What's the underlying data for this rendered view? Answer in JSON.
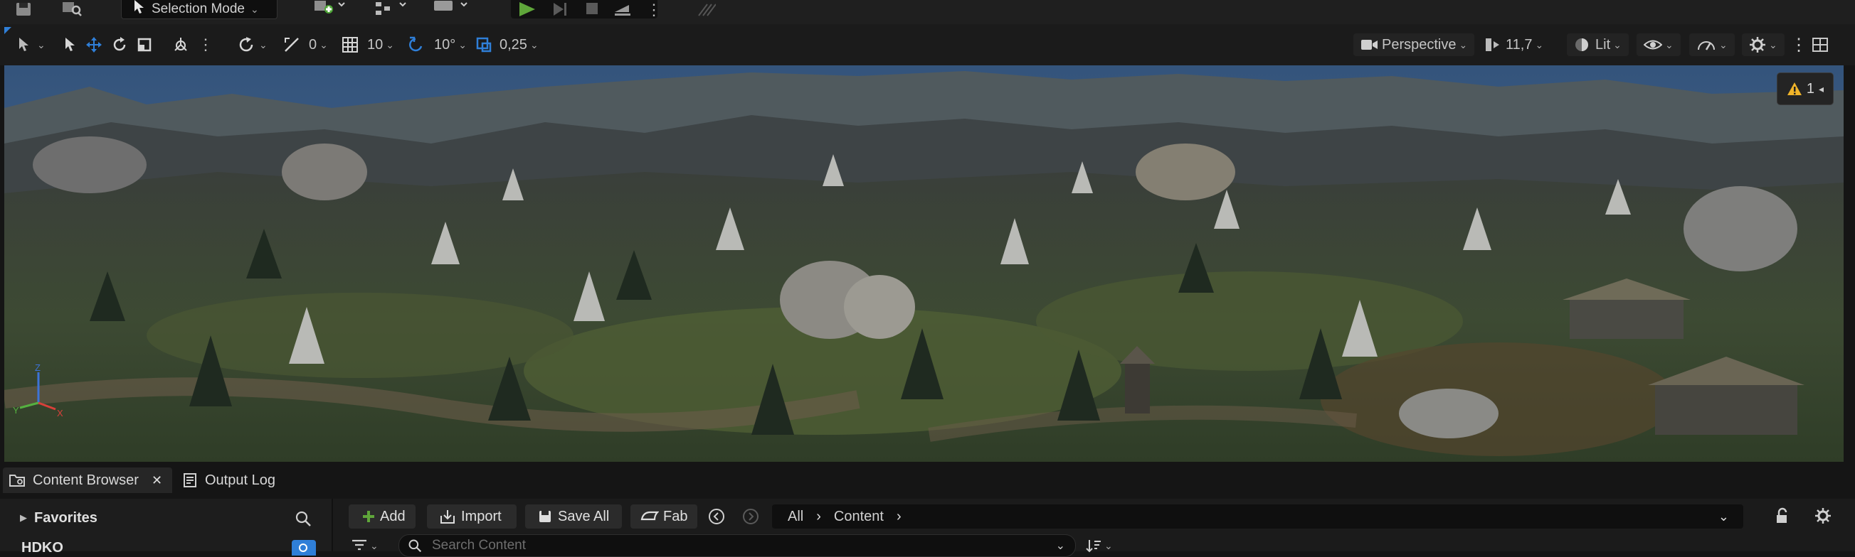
{
  "top_toolbar": {
    "selection_mode_label": "Selection Mode"
  },
  "viewport_toolbar": {
    "translate_snap": "0",
    "grid_snap": "10",
    "rotate_snap": "10°",
    "scale_snap": "0,25",
    "view_mode": "Perspective",
    "camera_speed": "11,7",
    "lighting_mode": "Lit"
  },
  "viewport": {
    "warning_count": "1",
    "axis_labels": {
      "z": "Z",
      "y": "Y",
      "x": "X"
    }
  },
  "tabs": {
    "content_browser": "Content Browser",
    "output_log": "Output Log"
  },
  "content_browser": {
    "favorites": "Favorites",
    "project_folder": "HDKO",
    "add_label": "Add",
    "import_label": "Import",
    "save_all_label": "Save All",
    "fab_label": "Fab",
    "path": [
      "All",
      "Content"
    ],
    "search_placeholder": "Search Content"
  },
  "colors": {
    "accent_blue": "#2f7fd8",
    "play_green": "#5fa63a",
    "warning_yellow": "#f0b429",
    "sky_blue": "#3f5f86"
  }
}
